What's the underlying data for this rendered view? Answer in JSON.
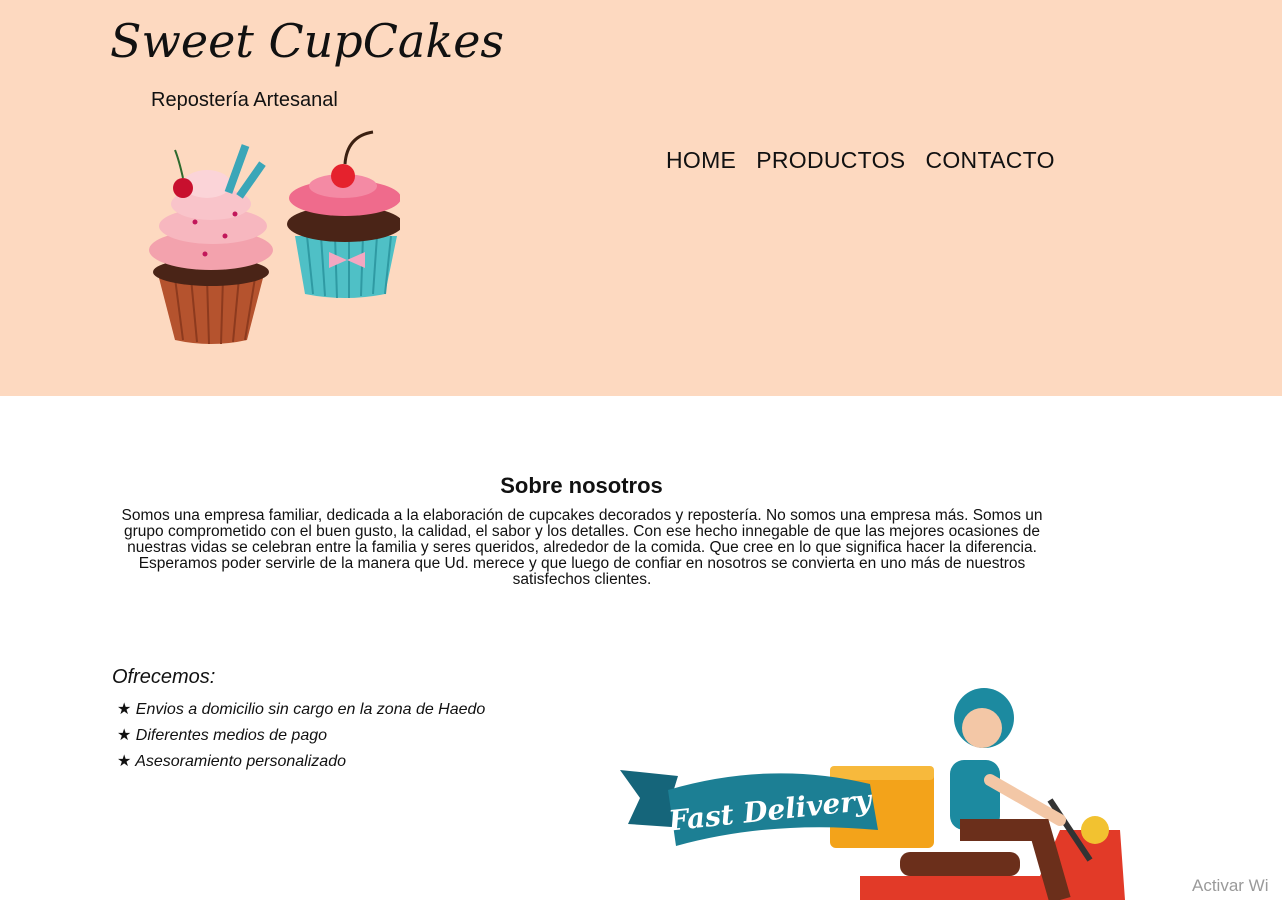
{
  "brand": {
    "title": "Sweet CupCakes",
    "subtitle": "Repostería Artesanal"
  },
  "nav": {
    "items": [
      "HOME",
      "PRODUCTOS",
      "CONTACTO"
    ]
  },
  "about": {
    "title": "Sobre nosotros",
    "text": "Somos una empresa familiar, dedicada a la elaboración de cupcakes decorados y repostería. No somos una empresa más. Somos un grupo comprometido con el buen gusto, la calidad, el sabor y los detalles. Con ese hecho innegable de que las mejores ocasiones de nuestras vidas se celebran entre la familia y seres queridos, alrededor de la comida. Que cree en lo que significa hacer la diferencia. Esperamos poder servirle de la manera que Ud. merece y que luego de confiar en nosotros se convierta en uno más de nuestros satisfechos clientes."
  },
  "offers": {
    "title": "Ofrecemos:",
    "items": [
      "★ Envios a domicilio sin cargo en la zona de Haedo",
      "★ Diferentes medios de pago",
      "★ Asesoramiento personalizado"
    ]
  },
  "delivery": {
    "banner_text": "Fast Delivery"
  },
  "watermark": "Activar Wi",
  "colors": {
    "header_bg": "#fdd9c0",
    "page_bg": "#ffffff"
  },
  "icons": [
    "cupcakes-illustration",
    "delivery-scooter-illustration"
  ]
}
